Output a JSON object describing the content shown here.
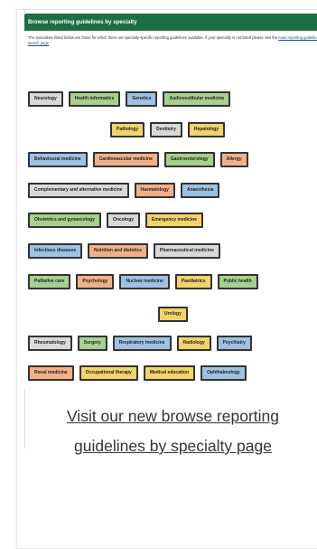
{
  "thumbnail": {
    "header_title": "Browse reporting guidelines by specialty",
    "intro_text": "The specialties listed below are those for which there are specialty-specific reporting guidelines available. If your specialty is not listed please visit the",
    "intro_link": "main reporting guidelines search page",
    "rows": [
      [
        {
          "label": "Neurology",
          "color": "gray"
        },
        {
          "label": "Health informatics",
          "color": "green"
        },
        {
          "label": "Genetics",
          "color": "blue"
        },
        {
          "label": "Audiovestibular medicine",
          "color": "green"
        }
      ],
      [
        {
          "label": "Pathology",
          "color": "yellow"
        },
        {
          "label": "Dentistry",
          "color": "gray"
        },
        {
          "label": "Hepatology",
          "color": "yellow"
        }
      ],
      [
        {
          "label": "Behavioural medicine",
          "color": "blue"
        },
        {
          "label": "Cardiovascular medicine",
          "color": "orange"
        },
        {
          "label": "Gastroenterology",
          "color": "green"
        },
        {
          "label": "Allergy",
          "color": "orange"
        }
      ],
      [
        {
          "label": "Complementary and alternative medicine",
          "color": "gray"
        },
        {
          "label": "Haematology",
          "color": "orange"
        },
        {
          "label": "Anaesthesia",
          "color": "blue"
        }
      ],
      [
        {
          "label": "Obstetrics and gynaecology",
          "color": "green"
        },
        {
          "label": "Oncology",
          "color": "gray"
        },
        {
          "label": "Emergency medicine",
          "color": "yellow"
        }
      ],
      [
        {
          "label": "Infectious diseases",
          "color": "blue"
        },
        {
          "label": "Nutrition and dietetics",
          "color": "orange"
        },
        {
          "label": "Pharmaceutical medicine",
          "color": "gray"
        }
      ],
      [
        {
          "label": "Palliative care",
          "color": "green"
        },
        {
          "label": "Psychology",
          "color": "orange"
        },
        {
          "label": "Nuclear medicine",
          "color": "blue"
        },
        {
          "label": "Paediatrics",
          "color": "yellow"
        },
        {
          "label": "Public health",
          "color": "green"
        }
      ],
      [
        {
          "label": "Urology",
          "color": "yellow"
        }
      ],
      [
        {
          "label": "Rheumatology",
          "color": "gray"
        },
        {
          "label": "Surgery",
          "color": "green"
        },
        {
          "label": "Respiratory medicine",
          "color": "blue"
        },
        {
          "label": "Radiology",
          "color": "yellow"
        },
        {
          "label": "Psychiatry",
          "color": "blue"
        }
      ],
      [
        {
          "label": "Renal medicine",
          "color": "orange"
        },
        {
          "label": "Occupational therapy",
          "color": "yellow"
        },
        {
          "label": "Medical education",
          "color": "yellow"
        },
        {
          "label": "Ophthalmology",
          "color": "blue"
        }
      ]
    ]
  },
  "caption": {
    "line1": "Visit our new browse reporting",
    "line2": "guidelines by specialty page"
  },
  "colors": {
    "header_green": "#1f6e41",
    "tag_gray": "#d9d9d9",
    "tag_green": "#a7d08c",
    "tag_blue": "#9ec1e4",
    "tag_yellow": "#f3d36a",
    "tag_orange": "#f2b089"
  }
}
